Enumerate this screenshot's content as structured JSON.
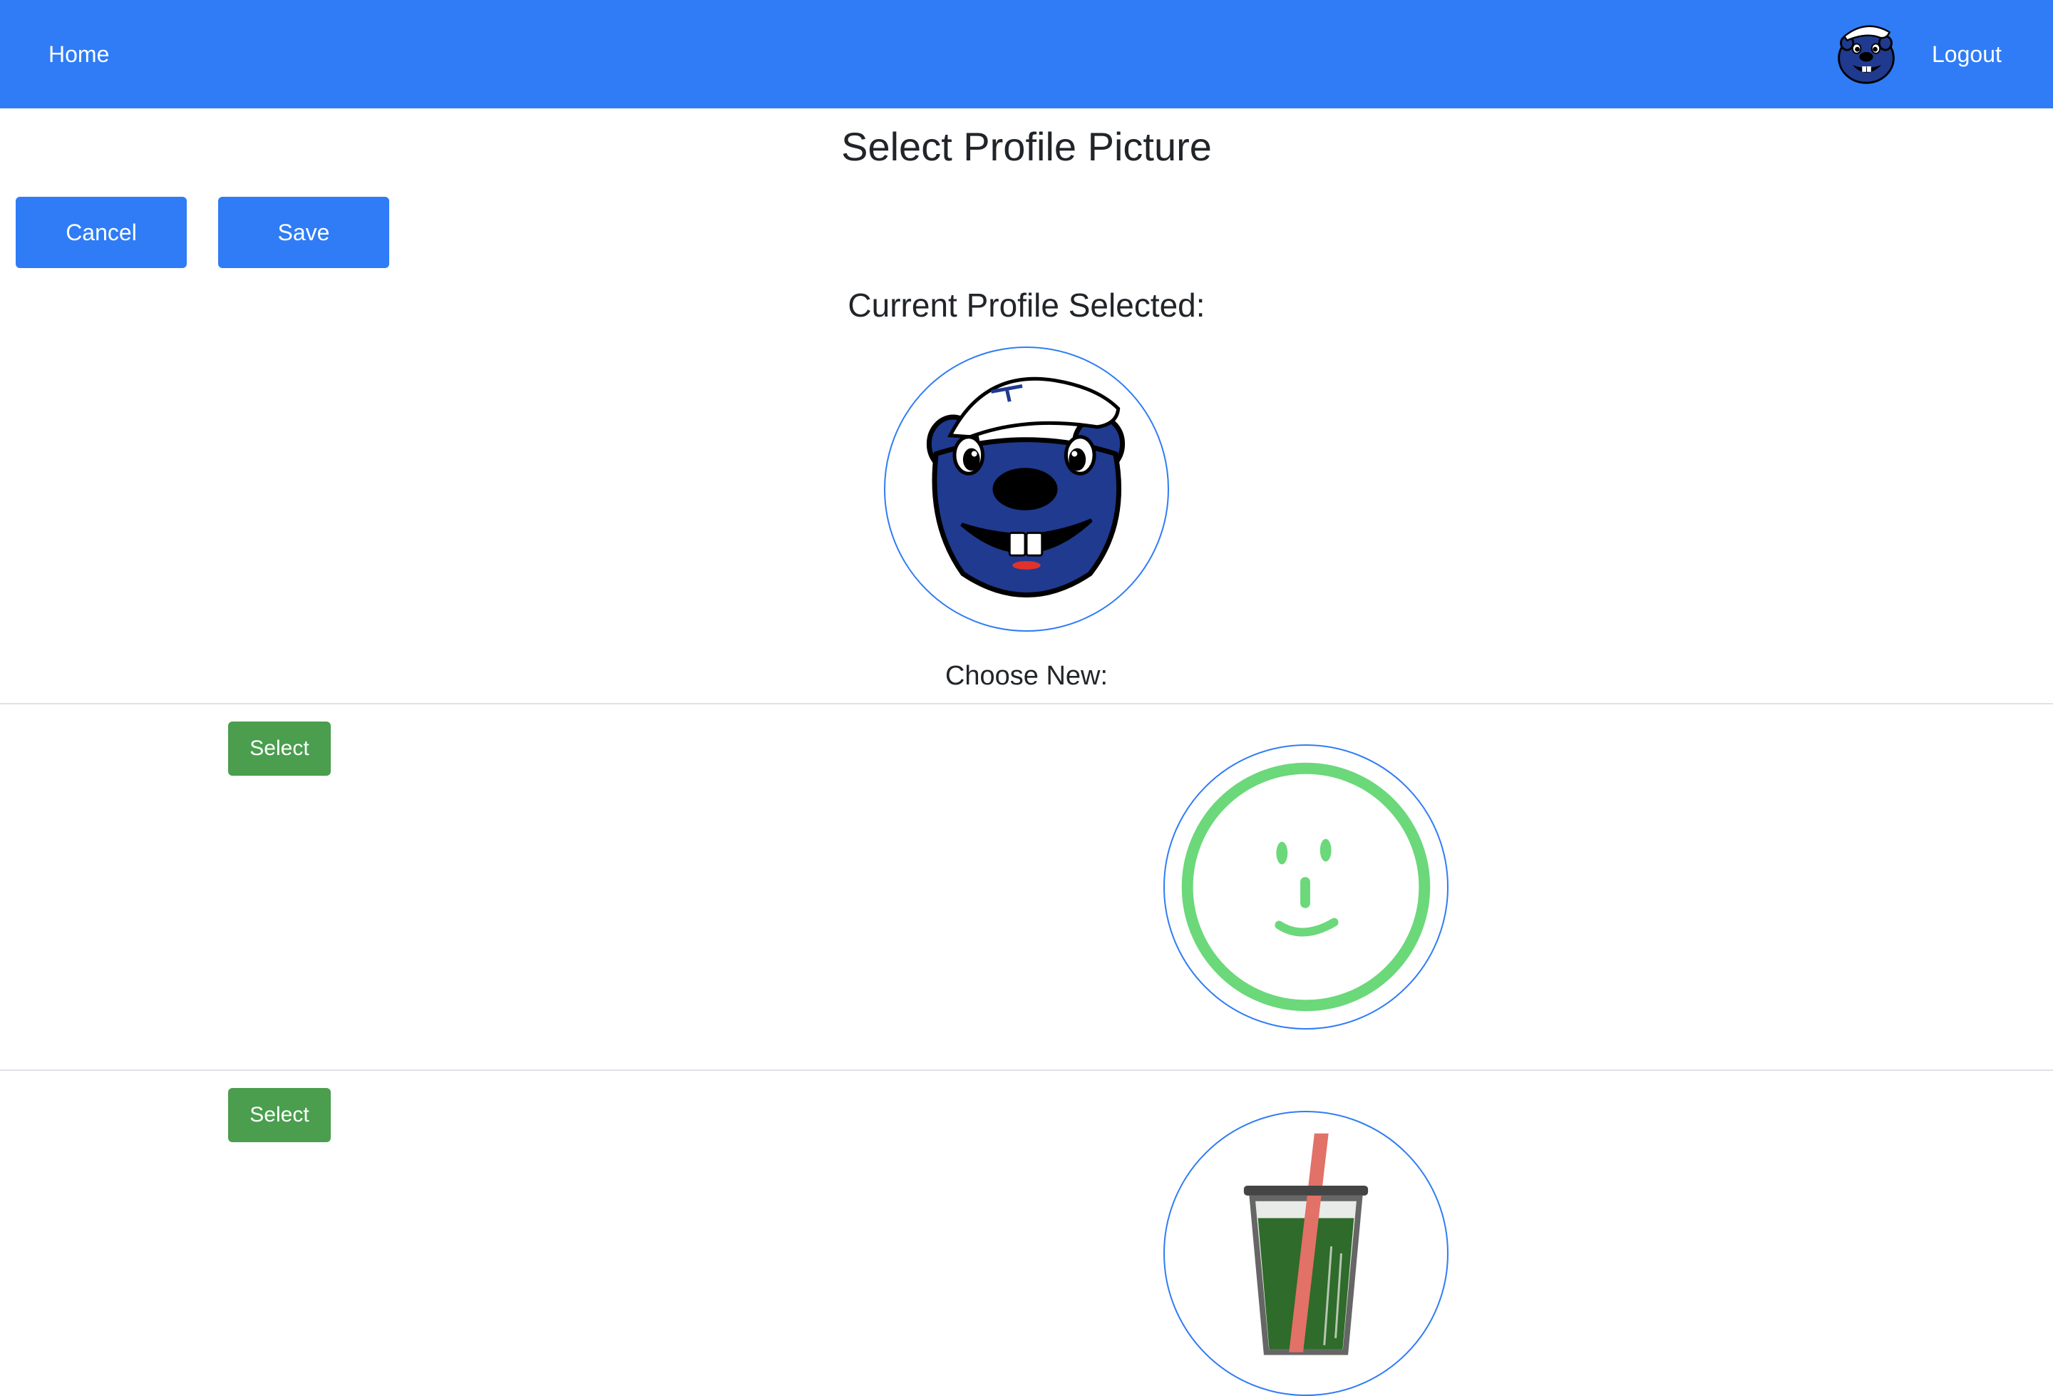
{
  "navbar": {
    "home_label": "Home",
    "logout_label": "Logout",
    "avatar_icon": "beaver-mascot-icon",
    "background_color": "#2f7cf6"
  },
  "page": {
    "title": "Select Profile Picture",
    "current_heading": "Current Profile Selected:",
    "choose_heading": "Choose New:"
  },
  "actions": {
    "cancel_label": "Cancel",
    "save_label": "Save"
  },
  "current_profile": {
    "icon": "beaver-mascot-icon"
  },
  "options": [
    {
      "select_label": "Select",
      "icon": "smiley-face-icon"
    },
    {
      "select_label": "Select",
      "icon": "green-drink-cup-icon"
    }
  ],
  "colors": {
    "primary": "#2f7cf6",
    "success": "#4a9e4e",
    "divider": "#dee2e6"
  }
}
